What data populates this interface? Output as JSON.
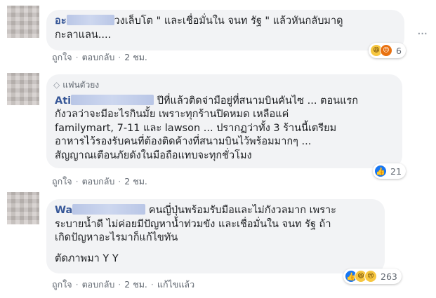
{
  "comments": [
    {
      "name": "อะ",
      "text": "วงเล็บโต \" และเชื่อมั่นใน จนท รัฐ \" แล้วหันกลับมาดูกะลาแลน....",
      "line1": "วงเล็บโต \" และเชื่อมั่นใน จนท รัฐ \" แล้วหันกลับมาดู",
      "line2": "กะลาแลน....",
      "reaction_count": "6",
      "actions": {
        "like": "ถูกใจ",
        "reply": "ตอบกลับ",
        "time": "2 ชม."
      }
    },
    {
      "badge": "แฟนตัวยง",
      "name": "Ati",
      "line1": "ปีที่แล้วติดจ่ามือยู่ที่สนามบินคันไซ ... ตอนแรก",
      "line2": "กังวลว่าจะมีอะไรกินมั้ย เพราะทุกร้านปิดหมด เหลือแค่",
      "line3": "familymart, 7-11 และ lawson ... ปรากฏว่าทั้ง 3 ร้านนี้เตรียม",
      "line4": "อาหารไว้รองรับคนที่ต้องติดค้างที่สนามบินไว้พร้อมมากๆ ...",
      "line5": "สัญญาณเตือนภัยดังในมือถือแทบจะทุกชั่วโมง",
      "reaction_count": "21",
      "actions": {
        "like": "ถูกใจ",
        "reply": "ตอบกลับ",
        "time": "2 ชม."
      }
    },
    {
      "name": "Wa",
      "line1": "คนญี่ปุ่นพร้อมรับมือและไม่กังวลมาก เพราะ",
      "line2": "ระบายน้ำดี ไม่ค่อยมีปัญหาน้ำท่วมขัง และเชื่อมั่นใน จนท รัฐ ถ้า",
      "line3": "เกิดปัญหาอะไรมาก็แก้ไขทัน",
      "line4": "ตัดภาพมา Y Y",
      "reaction_count": "263",
      "actions": {
        "like": "ถูกใจ",
        "reply": "ตอบกลับ",
        "time": "2 ชม.",
        "edited": "แก้ไขแล้ว"
      }
    }
  ],
  "more_options": "···",
  "colors": {
    "name": "#385898",
    "bubble": "#f2f3f5",
    "like": "#1877f2"
  },
  "icons": {
    "reactions": [
      "haha-icon",
      "angry-icon",
      "like-icon",
      "sad-icon"
    ],
    "badge": "diamond-icon"
  }
}
